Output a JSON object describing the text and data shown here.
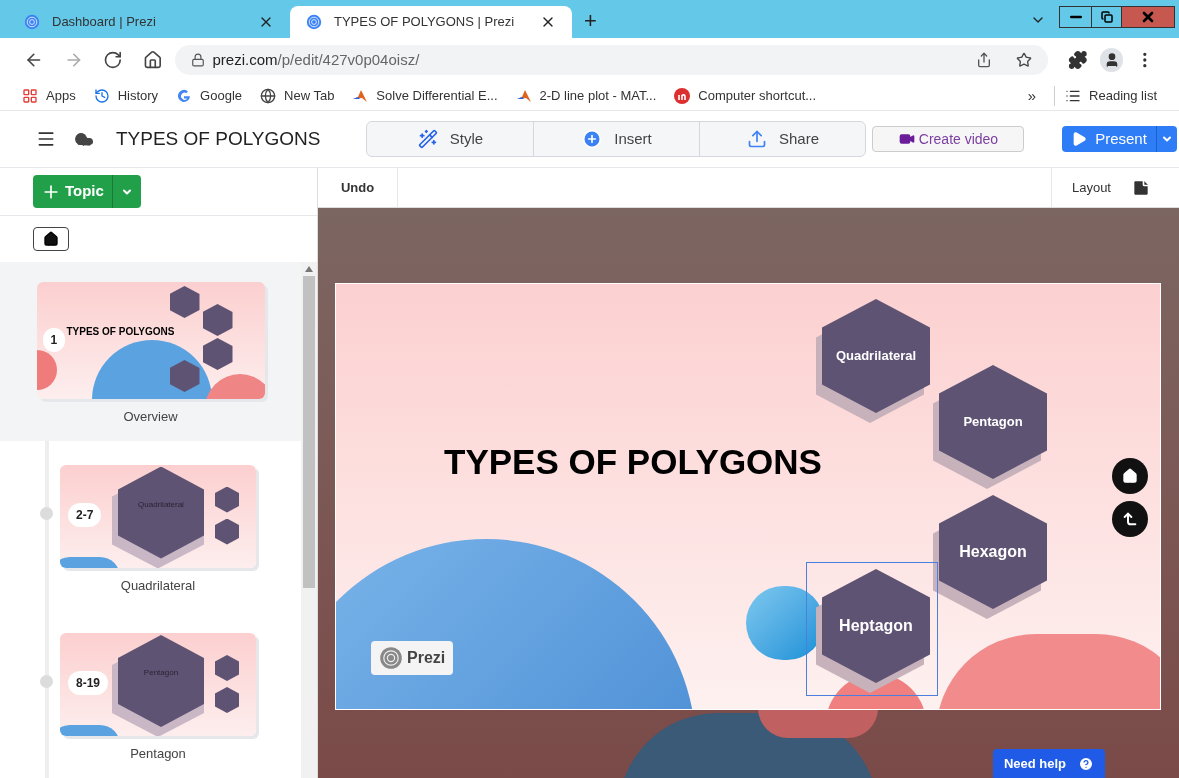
{
  "browser": {
    "tabs": [
      {
        "title": "Dashboard | Prezi",
        "selected": false
      },
      {
        "title": "TYPES OF POLYGONS | Prezi",
        "selected": true
      }
    ],
    "new_tab": "+",
    "url_host": "prezi.com",
    "url_path": "/p/edit/427v0p04oisz/",
    "bookmarks": [
      {
        "kind": "apps",
        "label": "Apps"
      },
      {
        "kind": "history",
        "label": "History"
      },
      {
        "kind": "google",
        "label": "Google"
      },
      {
        "kind": "globe",
        "label": "New Tab"
      },
      {
        "kind": "matlab",
        "label": "Solve Differential E..."
      },
      {
        "kind": "matlab",
        "label": "2-D line plot - MAT..."
      },
      {
        "kind": "invision",
        "label": "Computer shortcut..."
      }
    ],
    "more_bookmarks": "»",
    "reading_list": "Reading list"
  },
  "header": {
    "title": "TYPES OF POLYGONS",
    "tools": [
      {
        "kind": "style",
        "label": "Style"
      },
      {
        "kind": "insert",
        "label": "Insert"
      },
      {
        "kind": "share",
        "label": "Share"
      }
    ],
    "create_video": "Create video",
    "present": "Present"
  },
  "sidebar": {
    "topic_button": "Topic",
    "slides": [
      {
        "number": "1",
        "label": "Overview",
        "thumb_title": "TYPES OF POLYGONS",
        "kind": "overview",
        "selected": true
      },
      {
        "number": "2-7",
        "label": "Quadrilateral",
        "thumb_title": "Quadrilateral",
        "kind": "topic",
        "selected": false
      },
      {
        "number": "8-19",
        "label": "Pentagon",
        "thumb_title": "Pentagon",
        "kind": "topic",
        "selected": false
      }
    ]
  },
  "toolbar": {
    "undo": "Undo",
    "layout": "Layout"
  },
  "canvas": {
    "title": "TYPES OF POLYGONS",
    "topics": [
      {
        "label": "Quadrilateral",
        "selected": false
      },
      {
        "label": "Pentagon",
        "selected": false
      },
      {
        "label": "Hexagon",
        "selected": false
      },
      {
        "label": "Heptagon",
        "selected": true
      }
    ],
    "logo": "Prezi",
    "help": "Need help"
  }
}
